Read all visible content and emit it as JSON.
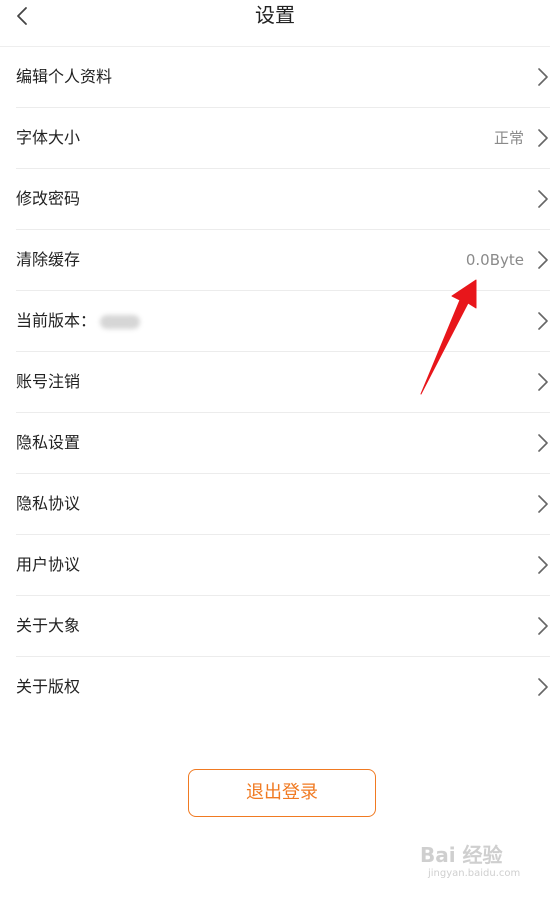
{
  "header": {
    "title": "设置",
    "back_icon": "chevron-left-icon"
  },
  "settings": {
    "items": [
      {
        "label": "编辑个人资料",
        "value": ""
      },
      {
        "label": "字体大小",
        "value": "正常"
      },
      {
        "label": "修改密码",
        "value": ""
      },
      {
        "label": "清除缓存",
        "value": "0.0Byte"
      },
      {
        "label": "当前版本：",
        "value": ""
      },
      {
        "label": "账号注销",
        "value": ""
      },
      {
        "label": "隐私设置",
        "value": ""
      },
      {
        "label": "隐私协议",
        "value": ""
      },
      {
        "label": "用户协议",
        "value": ""
      },
      {
        "label": "关于大象",
        "value": ""
      },
      {
        "label": "关于版权",
        "value": ""
      }
    ]
  },
  "logout": {
    "label": "退出登录"
  },
  "watermark": {
    "main": "Bai 经验",
    "sub": "jingyan.baidu.com"
  },
  "colors": {
    "accent": "#f07a22",
    "annotation_arrow": "#e8161b",
    "divider": "#ececec",
    "value_text": "#8a8a8a"
  }
}
